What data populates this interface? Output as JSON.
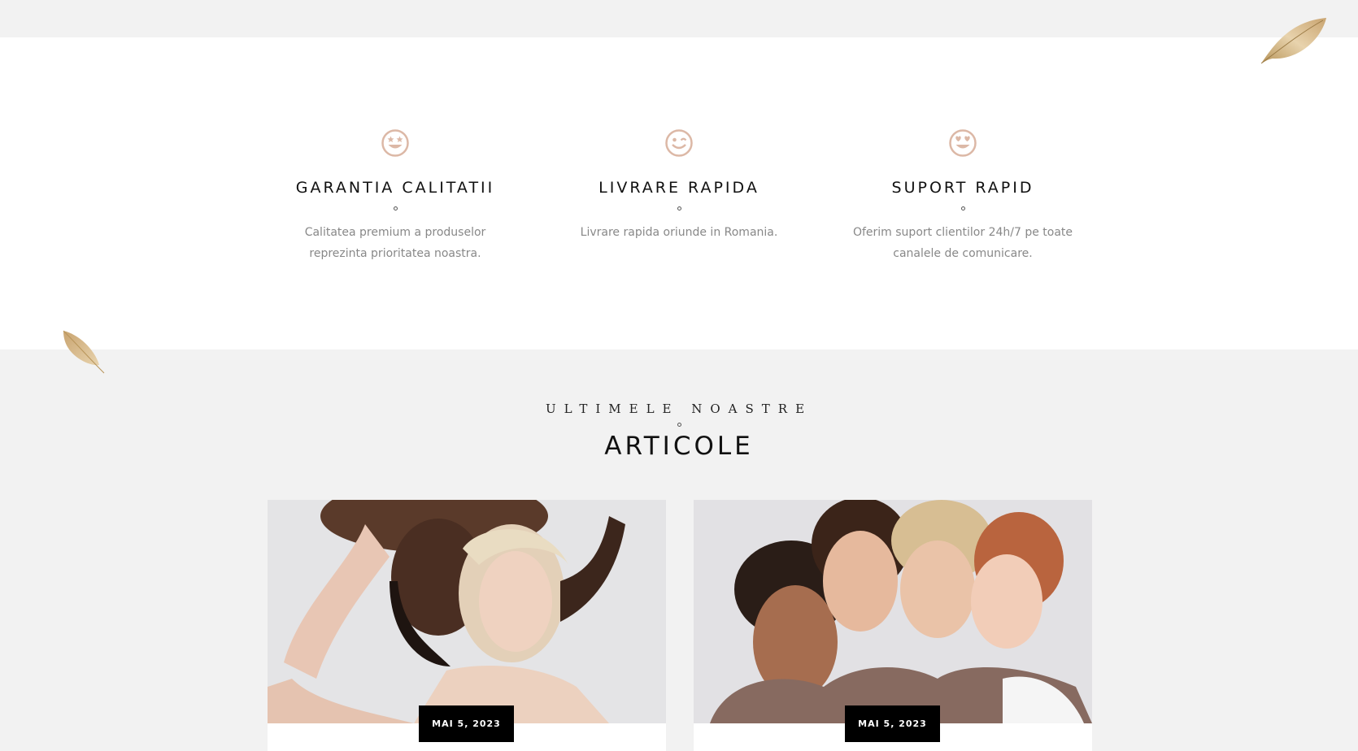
{
  "features": [
    {
      "icon": "star-eyes-smiley-icon",
      "title": "GARANTIA CALITATII",
      "text_line1": "Calitatea premium a produselor",
      "text_line2": "reprezinta prioritatea noastra."
    },
    {
      "icon": "winking-smiley-icon",
      "title": "LIVRARE RAPIDA",
      "text_line1": "Livrare rapida oriunde in Romania.",
      "text_line2": ""
    },
    {
      "icon": "heart-eyes-smiley-icon",
      "title": "SUPORT RAPID",
      "text_line1": "Oferim suport clientilor 24h/7 pe toate",
      "text_line2": "canalele de comunicare."
    }
  ],
  "blog": {
    "kicker": "ULTIMELE NOASTRE",
    "title": "ARTICOLE",
    "cards": [
      {
        "date": "MAI 5, 2023"
      },
      {
        "date": "MAI 5, 2023"
      }
    ]
  },
  "colors": {
    "accent": "#dcb8a6",
    "background": "#f2f2f2",
    "panel": "#ffffff",
    "badge": "#000000"
  }
}
